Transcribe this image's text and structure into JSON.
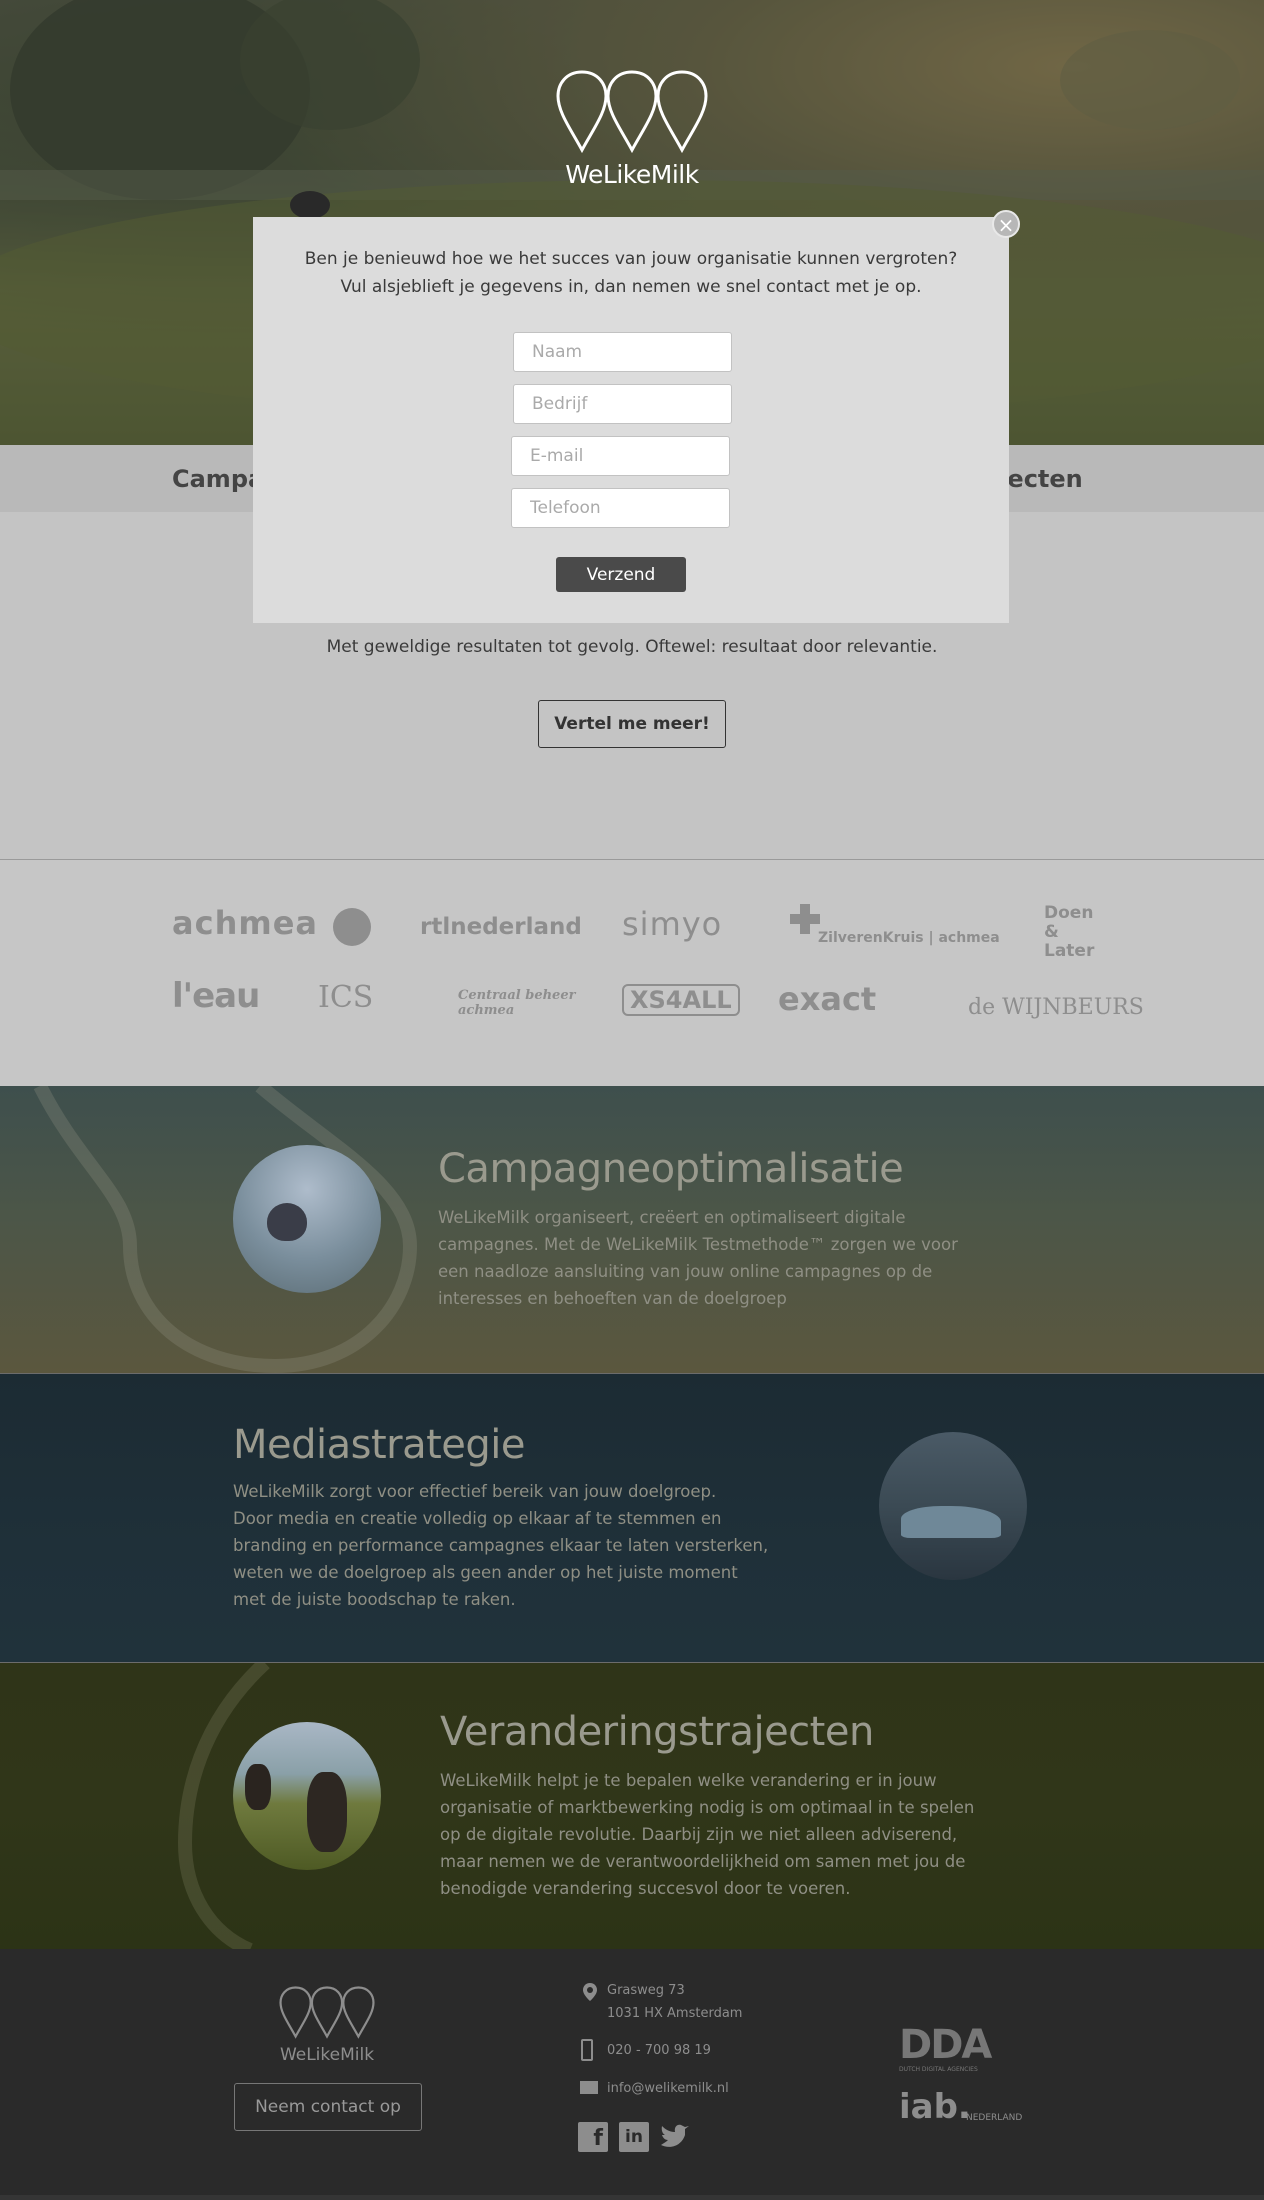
{
  "brand": {
    "name": "WeLikeMilk"
  },
  "nav": {
    "left_label": "Campa",
    "right_label": "ajecten"
  },
  "intro": {
    "line1": "...",
    "line2": "Met geweldige resultaten tot gevolg. Oftewel: resultaat door relevantie.",
    "cta_label": "Vertel me meer!"
  },
  "clients": [
    "achmea",
    "rtlnederland",
    "simyo",
    "ZilverenKruis | achmea",
    "Doen & Later",
    "l'eau",
    "ICS",
    "Centraal beheer achmea",
    "XS4ALL",
    "exact",
    "de WIJNBEURS"
  ],
  "services": [
    {
      "title": "Campagneoptimalisatie",
      "lines": [
        "WeLikeMilk organiseert, creëert en optimaliseert digitale",
        "campagnes. Met de WeLikeMilk Testmethode™ zorgen we voor",
        "een naadloze aansluiting van jouw online campagnes op de",
        "interesses en behoeften van de doelgroep"
      ]
    },
    {
      "title": "Mediastrategie",
      "lines": [
        "WeLikeMilk zorgt voor effectief bereik van jouw doelgroep.",
        "Door media en creatie volledig op elkaar af te stemmen en",
        "branding en performance campagnes elkaar te laten versterken,",
        "weten we de doelgroep als geen ander op het juiste moment",
        "met de juiste boodschap te raken."
      ]
    },
    {
      "title": "Veranderingstrajecten",
      "lines": [
        "WeLikeMilk helpt je te bepalen welke verandering er in jouw",
        "organisatie of marktbewerking nodig is om optimaal in te spelen",
        "op de digitale revolutie. Daarbij zijn we niet alleen adviserend,",
        "maar nemen we de verantwoordelijkheid om samen met jou de",
        "benodigde verandering succesvol door te voeren."
      ]
    }
  ],
  "footer": {
    "contact_label": "Neem contact op",
    "address1": "Grasweg 73",
    "address2": "1031 HX Amsterdam",
    "phone": "020 - 700 98 19",
    "email": "info@welikemilk.nl",
    "dda_label": "DDA",
    "dda_sub": "DUTCH DIGITAL AGENCIES",
    "iab_label": "iab.",
    "iab_sub": "NEDERLAND"
  },
  "modal": {
    "question1": "Ben je benieuwd hoe we het succes van jouw organisatie kunnen vergroten?",
    "question2": "Vul alsjeblieft je gegevens in, dan nemen we snel contact met je op.",
    "name_placeholder": "Naam",
    "company_placeholder": "Bedrijf",
    "email_placeholder": "E-mail",
    "phone_placeholder": "Telefoon",
    "send_label": "Verzend",
    "close_label": "×"
  }
}
